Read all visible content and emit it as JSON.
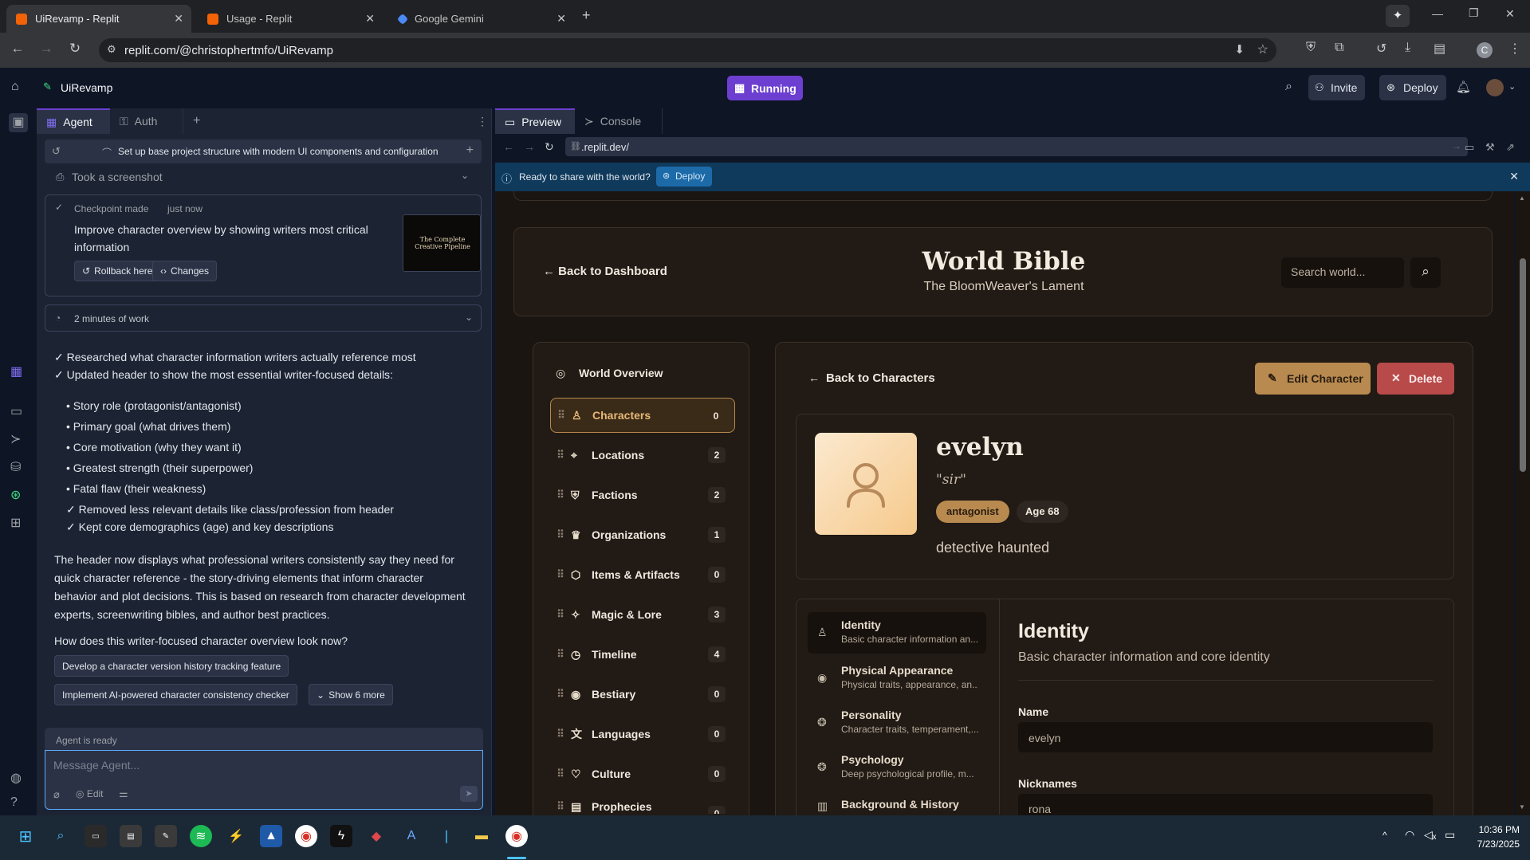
{
  "browser": {
    "tabs": [
      {
        "title": "UiRevamp - Replit"
      },
      {
        "title": "Usage - Replit"
      },
      {
        "title": "Google Gemini"
      }
    ],
    "url": "replit.com/@christophertmfo/UiRevamp"
  },
  "replit": {
    "project_name": "UiRevamp",
    "run_status": "Running",
    "invite_label": "Invite",
    "deploy_label": "Deploy",
    "panel_tabs": [
      "Agent",
      "Auth"
    ],
    "preview_tabs": [
      "Preview",
      "Console"
    ],
    "preview_url": ".replit.dev/",
    "banner_text": "Ready to share with the world?",
    "banner_deploy": "Deploy"
  },
  "agent": {
    "history_title": "Set up base project structure with modern UI components and configuration",
    "screenshot_note": "Took a screenshot",
    "checkpoint_label": "Checkpoint made",
    "checkpoint_time": "just now",
    "checkpoint_text": "Improve character overview by showing writers most critical information",
    "rollback_label": "Rollback here",
    "changes_label": "Changes",
    "thumb_title": "The Complete Creative Pipeline",
    "work_time": "2 minutes of work",
    "check_lines": [
      "✓ Researched what character information writers actually reference most",
      "✓ Updated header to show the most essential writer-focused details:"
    ],
    "bullets": [
      "Story role (protagonist/antagonist)",
      "Primary goal (what drives them)",
      "Core motivation (why they want it)",
      "Greatest strength (their superpower)",
      "Fatal flaw (their weakness)"
    ],
    "sub_checks": [
      "✓ Removed less relevant details like class/profession from header",
      "✓ Kept core demographics (age) and key descriptions"
    ],
    "paragraph_lines": [
      "The header now displays what professional writers consistently say they need for",
      "quick character reference - the story-driving elements that inform character",
      "behavior and plot decisions. This is based on research from character development",
      "experts, screenwriting bibles, and author best practices."
    ],
    "question": "How does this writer-focused character overview look now?",
    "suggestions": [
      "Develop a character version history tracking feature",
      "Implement AI-powered character consistency checker"
    ],
    "show_more": "Show 6 more",
    "status": "Agent is ready",
    "input_placeholder": "Message Agent...",
    "edit_label": "Edit"
  },
  "site": {
    "back_dashboard": "← Back to Dashboard",
    "title": "World Bible",
    "subtitle": "The BloomWeaver's Lament",
    "search_placeholder": "Search world...",
    "overview_label": "World Overview",
    "sidebar": [
      {
        "label": "Characters",
        "count": "0",
        "icon": "user-icon"
      },
      {
        "label": "Locations",
        "count": "2",
        "icon": "map-pin-icon"
      },
      {
        "label": "Factions",
        "count": "2",
        "icon": "shield-icon"
      },
      {
        "label": "Organizations",
        "count": "1",
        "icon": "crown-icon"
      },
      {
        "label": "Items & Artifacts",
        "count": "0",
        "icon": "box-icon"
      },
      {
        "label": "Magic & Lore",
        "count": "3",
        "icon": "sparkles-icon"
      },
      {
        "label": "Timeline",
        "count": "4",
        "icon": "clock-icon"
      },
      {
        "label": "Bestiary",
        "count": "0",
        "icon": "eye-icon"
      },
      {
        "label": "Languages",
        "count": "0",
        "icon": "languages-icon"
      },
      {
        "label": "Culture",
        "count": "0",
        "icon": "heart-icon"
      },
      {
        "label": "Prophecies",
        "count": "0",
        "icon": "scroll-icon"
      }
    ],
    "back_characters": "Back to Characters",
    "edit_character": "Edit Character",
    "delete_label": "Delete",
    "character": {
      "name": "evelyn",
      "quote": "\"sir\"",
      "role": "antagonist",
      "age": "Age 68",
      "description": "detective haunted"
    },
    "detail_tabs": [
      {
        "title": "Identity",
        "sub": "Basic character information an..."
      },
      {
        "title": "Physical Appearance",
        "sub": "Physical traits, appearance, an..."
      },
      {
        "title": "Personality",
        "sub": "Character traits, temperament,..."
      },
      {
        "title": "Psychology",
        "sub": "Deep psychological profile, m..."
      },
      {
        "title": "Background & History",
        "sub": ""
      }
    ],
    "identity": {
      "heading": "Identity",
      "sub": "Basic character information and core identity",
      "name_label": "Name",
      "name_value": "evelyn",
      "nicknames_label": "Nicknames",
      "nicknames_value": "rona"
    }
  },
  "taskbar": {
    "time": "10:36 PM",
    "date": "7/23/2025"
  },
  "colors": {
    "accent_gold": "#b88a4f",
    "delete_red": "#b84a4a",
    "run_purple": "#6c3fd0"
  }
}
